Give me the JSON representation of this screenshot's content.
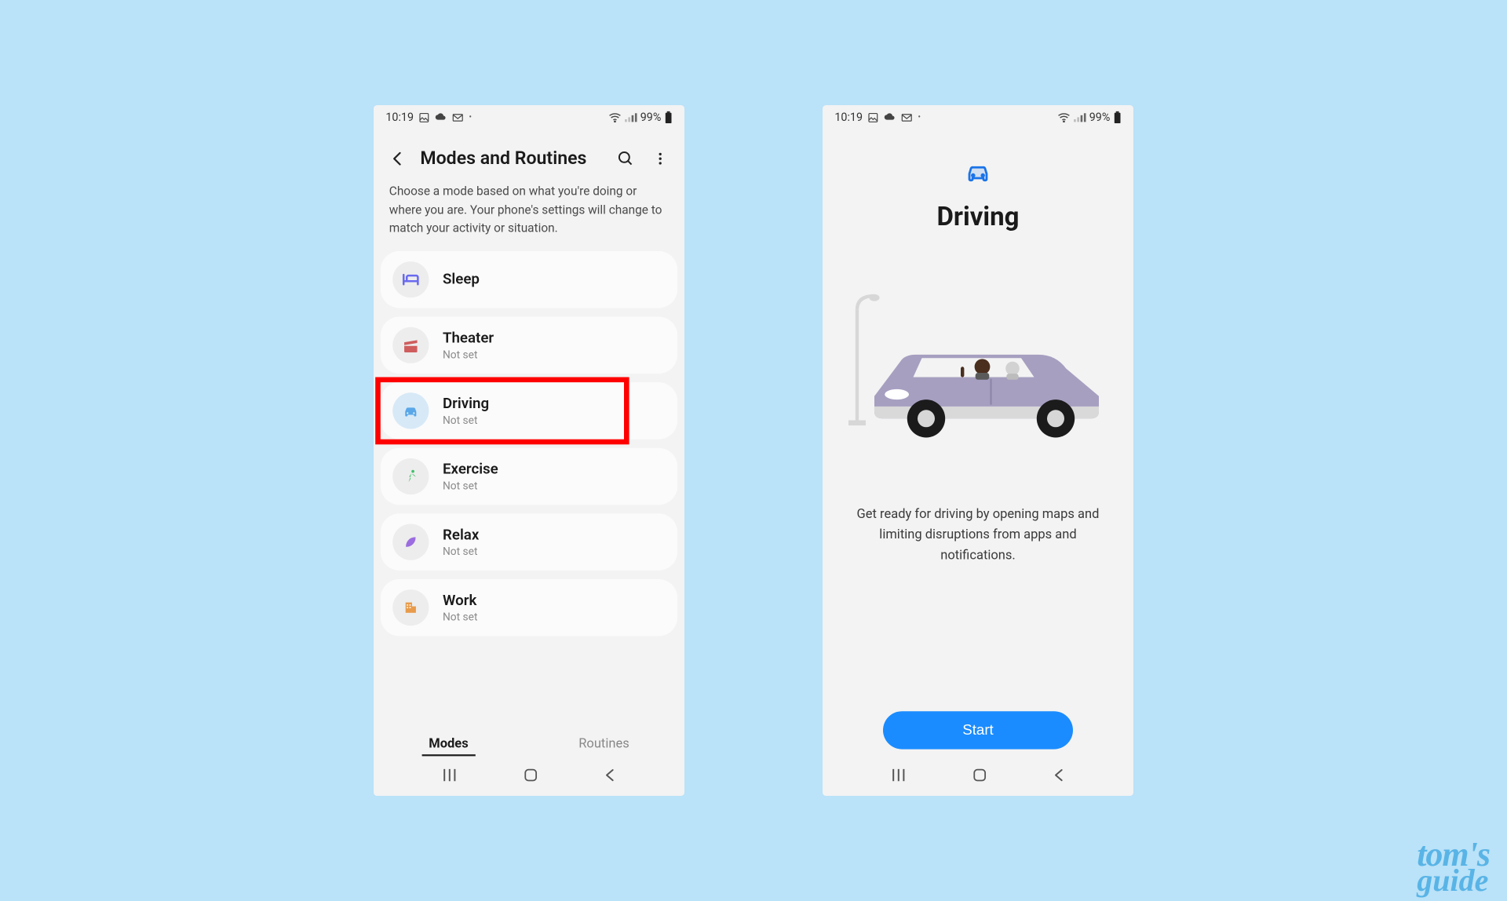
{
  "status": {
    "time": "10:19",
    "battery": "99%"
  },
  "screen1": {
    "title": "Modes and Routines",
    "subtitle": "Choose a mode based on what you're doing or where you are. Your phone's settings will change to match your activity or situation.",
    "modes": [
      {
        "label": "Sleep",
        "sub": ""
      },
      {
        "label": "Theater",
        "sub": "Not set"
      },
      {
        "label": "Driving",
        "sub": "Not set"
      },
      {
        "label": "Exercise",
        "sub": "Not set"
      },
      {
        "label": "Relax",
        "sub": "Not set"
      },
      {
        "label": "Work",
        "sub": "Not set"
      }
    ],
    "tabs": {
      "modes": "Modes",
      "routines": "Routines"
    }
  },
  "screen2": {
    "title": "Driving",
    "desc": "Get ready for driving by opening maps and limiting disruptions from apps and notifications.",
    "start": "Start"
  },
  "watermark": {
    "line1": "tom's",
    "line2": "guide"
  },
  "colors": {
    "accent": "#1a8cff",
    "sleep": "#6a6af0",
    "theater": "#cf5d5d",
    "driving": "#5aa7e8",
    "exercise": "#3fc169",
    "relax": "#9b6de0",
    "work": "#e89b4a"
  }
}
